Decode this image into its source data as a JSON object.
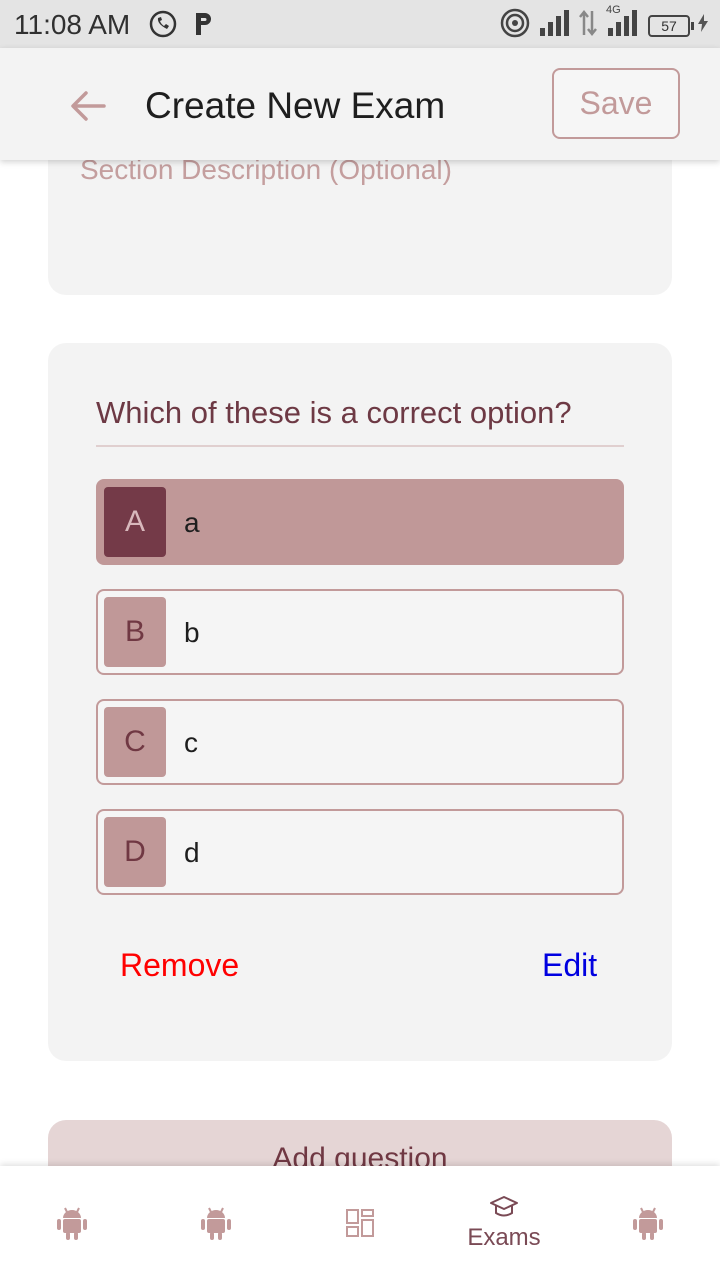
{
  "status_bar": {
    "time": "11:08 AM",
    "network": "4G",
    "battery": "57",
    "icons": [
      "whatsapp-icon",
      "parking-icon",
      "hotspot-icon",
      "signal-icon",
      "data-arrows-icon",
      "signal-4g-icon",
      "battery-icon"
    ]
  },
  "app_bar": {
    "title": "Create New Exam",
    "save_label": "Save",
    "back_icon": "arrow-left-icon"
  },
  "section": {
    "description_placeholder": "Section Description (Optional)"
  },
  "question": {
    "text": "Which of these is a correct option?",
    "options": [
      {
        "letter": "A",
        "text": "a",
        "selected": true
      },
      {
        "letter": "B",
        "text": "b",
        "selected": false
      },
      {
        "letter": "C",
        "text": "c",
        "selected": false
      },
      {
        "letter": "D",
        "text": "d",
        "selected": false
      }
    ],
    "remove_label": "Remove",
    "edit_label": "Edit"
  },
  "add_question_label": "Add question",
  "bottom_nav": {
    "items": [
      {
        "icon": "android-icon",
        "label": ""
      },
      {
        "icon": "android-icon",
        "label": ""
      },
      {
        "icon": "grid-icon",
        "label": ""
      },
      {
        "icon": "graduation-cap-icon",
        "label": "Exams"
      },
      {
        "icon": "android-icon",
        "label": ""
      }
    ]
  },
  "colors": {
    "accent": "#703843",
    "accent_light": "#c09898",
    "remove": "#ff0000",
    "edit": "#0000e0"
  }
}
